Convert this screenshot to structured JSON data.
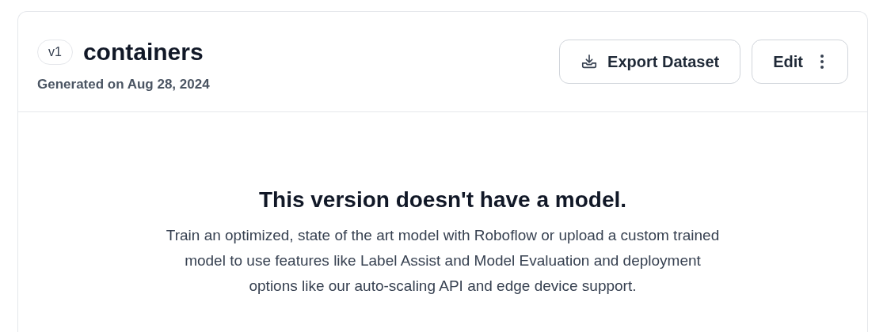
{
  "version": {
    "badge": "v1",
    "name": "containers",
    "generated": "Generated on Aug 28, 2024"
  },
  "actions": [
    {
      "kind": "export",
      "label": "Export Dataset"
    },
    {
      "kind": "edit",
      "label": "Edit"
    }
  ],
  "empty_state": {
    "title": "This version doesn't have a model.",
    "description": "Train an optimized, state of the art model with Roboflow or upload a custom trained model to use features like Label Assist and Model Evaluation and deployment options like our auto-scaling API and edge device support."
  }
}
